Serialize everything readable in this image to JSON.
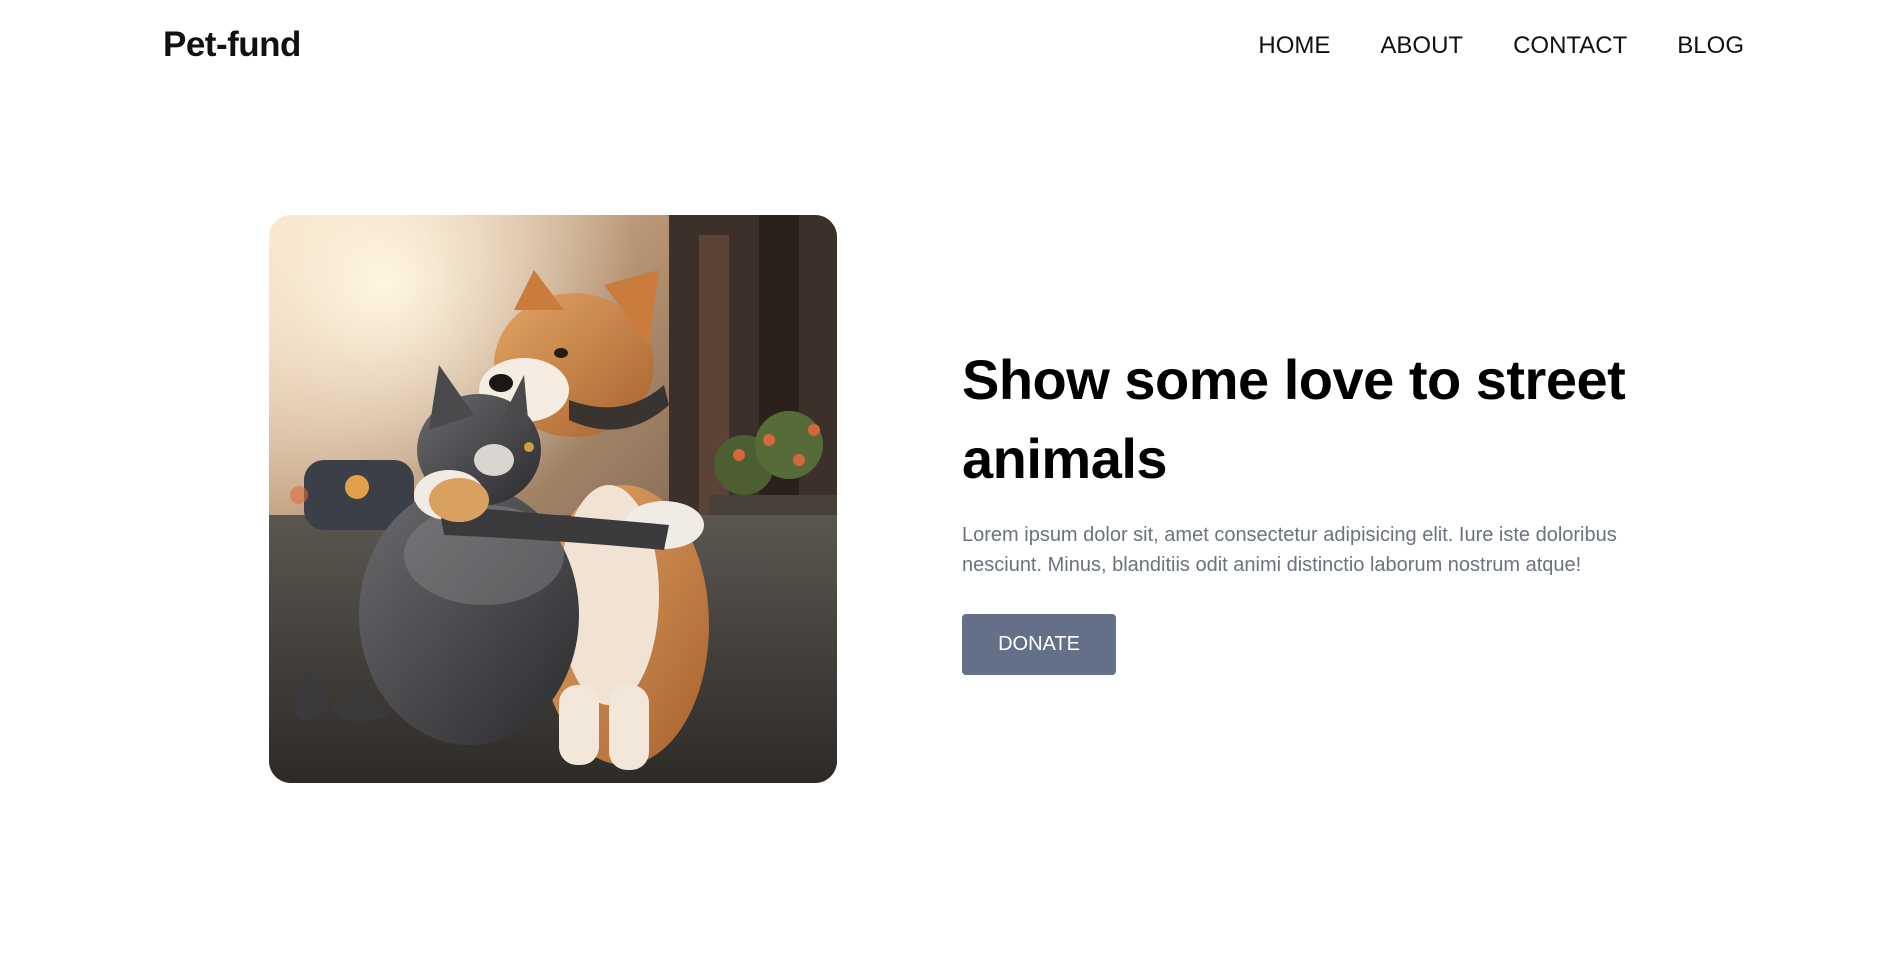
{
  "header": {
    "logo": "Pet-fund",
    "nav": [
      {
        "label": "HOME"
      },
      {
        "label": "ABOUT"
      },
      {
        "label": "CONTACT"
      },
      {
        "label": "BLOG"
      }
    ]
  },
  "hero": {
    "title": "Show some love to street animals",
    "description": "Lorem ipsum dolor sit, amet consectetur adipisicing elit. Iure iste doloribus nesciunt. Minus, blanditiis odit animi distinctio laborum nostrum atque!",
    "donate_label": "DONATE"
  },
  "colors": {
    "button": "#647089",
    "description_text": "#6b7280",
    "title_text": "#000000"
  }
}
